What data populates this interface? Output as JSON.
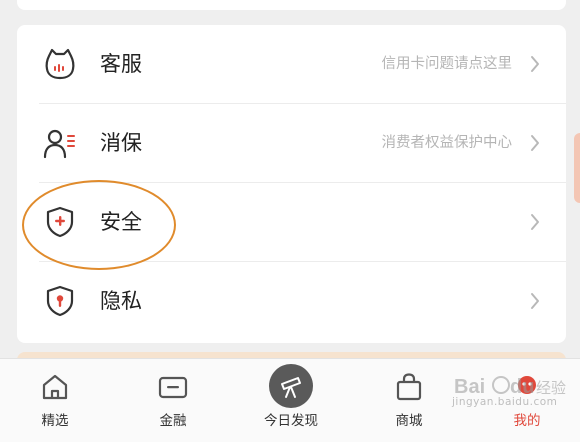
{
  "menu": {
    "items": [
      {
        "label": "客服",
        "hint": "信用卡问题请点这里",
        "icon": "cat-service-icon"
      },
      {
        "label": "消保",
        "hint": "消费者权益保护中心",
        "icon": "user-list-icon"
      },
      {
        "label": "安全",
        "hint": "",
        "icon": "shield-plus-icon"
      },
      {
        "label": "隐私",
        "hint": "",
        "icon": "shield-lock-icon"
      }
    ]
  },
  "tabbar": {
    "tabs": [
      {
        "label": "精选",
        "icon": "home-icon"
      },
      {
        "label": "金融",
        "icon": "card-icon"
      },
      {
        "label": "今日发现",
        "icon": "telescope-icon"
      },
      {
        "label": "商城",
        "icon": "shopping-bag-icon"
      },
      {
        "label": "我的",
        "icon": "profile-icon"
      }
    ]
  },
  "colors": {
    "accent": "#e0483b",
    "highlight": "#e08b2c",
    "text": "#222222",
    "hint": "#b5b5b5"
  },
  "watermark": {
    "brand_a": "Bai",
    "brand_b": "du",
    "brand_c": "经验",
    "url": "jingyan.baidu.com"
  }
}
